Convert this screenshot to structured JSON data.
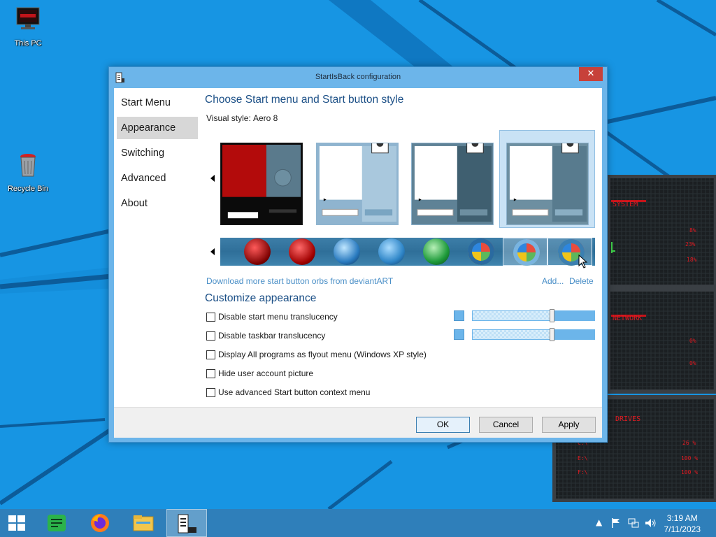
{
  "desktop": {
    "icons": [
      {
        "label": "This PC",
        "icon": "computer-icon"
      },
      {
        "label": "Recycle Bin",
        "icon": "recycle-bin-icon"
      }
    ]
  },
  "window": {
    "title": "StartIsBack configuration",
    "close_glyph": "✕"
  },
  "sidebar": {
    "items": [
      {
        "label": "Start Menu",
        "selected": false
      },
      {
        "label": "Appearance",
        "selected": true
      },
      {
        "label": "Switching",
        "selected": false
      },
      {
        "label": "Advanced",
        "selected": false
      },
      {
        "label": "About",
        "selected": false
      }
    ]
  },
  "main": {
    "heading_style": "Choose Start menu and Start button style",
    "visual_style_label": "Visual style:",
    "visual_style_value": "Aero 8",
    "download_link": "Download more start button orbs from deviantART",
    "add_link": "Add...",
    "delete_link": "Delete",
    "heading_customize": "Customize appearance",
    "options": [
      {
        "label": "Disable start menu translucency",
        "checked": false
      },
      {
        "label": "Disable taskbar translucency",
        "checked": false
      },
      {
        "label": "Display All programs as flyout menu (Windows XP style)",
        "checked": false
      },
      {
        "label": "Hide user account picture",
        "checked": false
      },
      {
        "label": "Use advanced Start button context menu",
        "checked": false
      }
    ],
    "accent_color": "#6cb5ea"
  },
  "footer": {
    "ok": "OK",
    "cancel": "Cancel",
    "apply": "Apply"
  },
  "widget": {
    "system_title": "SYSTEM",
    "network_title": "NETWORK",
    "drives_title": "DRIVES",
    "system_values": [
      "8%",
      "23%",
      "18%"
    ],
    "network_values": [
      "0%",
      "0%"
    ],
    "drive_rows": [
      {
        "label": "C:\\",
        "value": "26 %"
      },
      {
        "label": "E:\\",
        "value": "100 %"
      },
      {
        "label": "F:\\",
        "value": "100 %"
      }
    ]
  },
  "taskbar": {
    "items": [
      "start-icon",
      "notes-app-icon",
      "firefox-icon",
      "file-explorer-icon",
      "startisback-config-icon"
    ],
    "time": "3:19 AM",
    "date": "7/11/2023"
  }
}
